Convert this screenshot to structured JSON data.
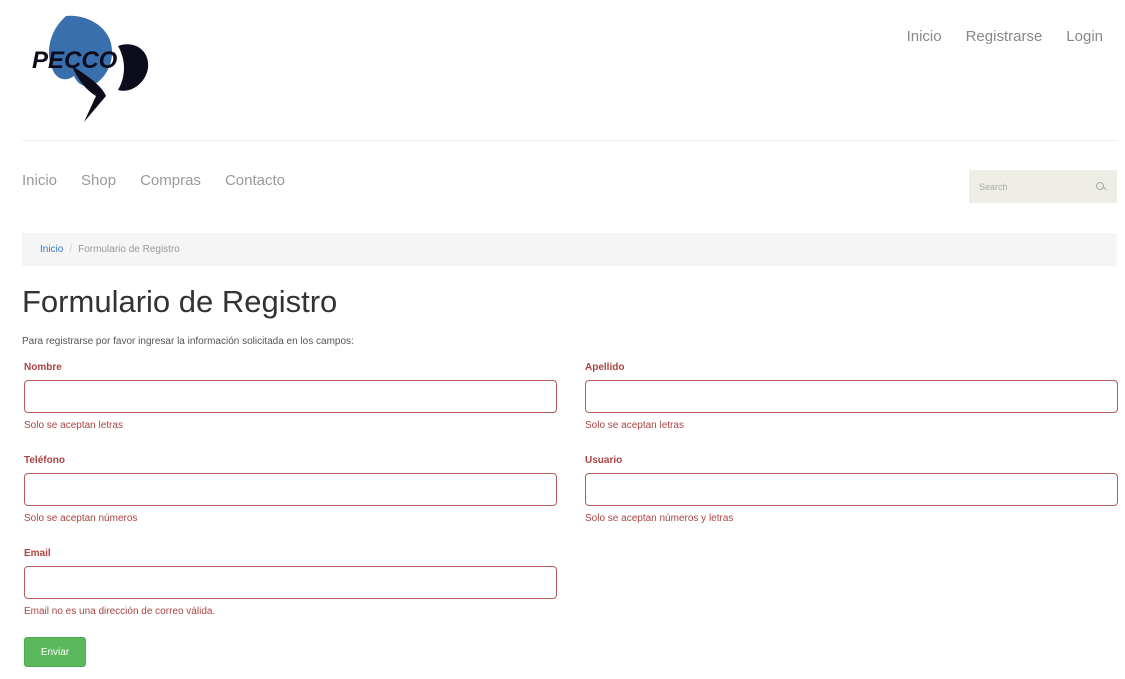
{
  "brand": {
    "logo_text": "PECCO",
    "logo_primary": "#3a6fae",
    "logo_dark": "#0c0c1c"
  },
  "top_nav": [
    "Inicio",
    "Registrarse",
    "Login"
  ],
  "main_nav": [
    "Inicio",
    "Shop",
    "Compras",
    "Contacto"
  ],
  "search": {
    "placeholder": "Search",
    "icon": "search-icon"
  },
  "breadcrumb": {
    "home": "Inicio",
    "separator": "/",
    "current": "Formulario de Registro"
  },
  "page": {
    "title": "Formulario de Registro",
    "intro": "Para registrarse por favor ingresar la información solicitada en los campos:"
  },
  "fields": {
    "nombre": {
      "label": "Nombre",
      "value": "",
      "help": "Solo se aceptan letras"
    },
    "apellido": {
      "label": "Apellido",
      "value": "",
      "help": "Solo se aceptan letras"
    },
    "telefono": {
      "label": "Teléfono",
      "value": "",
      "help": "Solo se aceptan números"
    },
    "usuario": {
      "label": "Usuario",
      "value": "",
      "help": "Solo se aceptan números y letras"
    },
    "email": {
      "label": "Email",
      "value": "",
      "help": "Email no es una dirección de correo válida."
    }
  },
  "submit_label": "Enviar",
  "colors": {
    "error": "#a94442",
    "link": "#3b7bbf",
    "success": "#5cb85c"
  }
}
